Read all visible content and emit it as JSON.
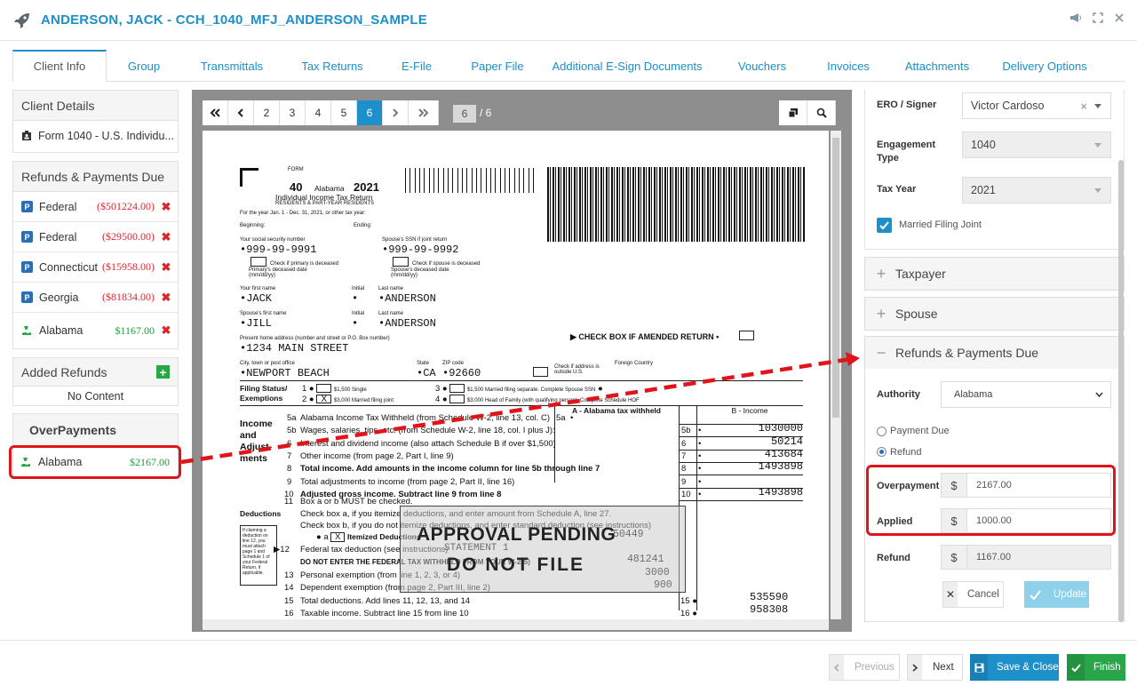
{
  "window": {
    "title": "ANDERSON, JACK - CCH_1040_MFJ_ANDERSON_SAMPLE",
    "icons": [
      "rocket-icon",
      "megaphone-icon",
      "expand-icon",
      "close-icon"
    ]
  },
  "tabs": [
    {
      "label": "Client Info",
      "active": true
    },
    {
      "label": "Group"
    },
    {
      "label": "Transmittals"
    },
    {
      "label": "Tax Returns"
    },
    {
      "label": "E-File"
    },
    {
      "label": "Paper File"
    },
    {
      "label": "Additional E-Sign Documents"
    },
    {
      "label": "Vouchers"
    },
    {
      "label": "Invoices"
    },
    {
      "label": "Attachments"
    },
    {
      "label": "Delivery Options"
    }
  ],
  "left": {
    "client_details": {
      "header": "Client Details",
      "item": "Form 1040 - U.S. Individu..."
    },
    "refunds": {
      "header": "Refunds & Payments Due",
      "items": [
        {
          "name": "Federal",
          "amount": "($501224.00)",
          "kind": "payment"
        },
        {
          "name": "Federal",
          "amount": "($29500.00)",
          "kind": "payment"
        },
        {
          "name": "Connecticut",
          "amount": "($15958.00)",
          "kind": "payment"
        },
        {
          "name": "Georgia",
          "amount": "($81834.00)",
          "kind": "payment"
        },
        {
          "name": "Alabama",
          "amount": "$1167.00",
          "kind": "refund"
        }
      ]
    },
    "added_refunds": {
      "header": "Added Refunds",
      "empty": "No Content"
    },
    "overpayments": {
      "header": "OverPayments",
      "item_name": "Alabama",
      "item_amount": "$2167.00"
    }
  },
  "viewer": {
    "pages": [
      "2",
      "3",
      "4",
      "5",
      "6"
    ],
    "current_page": "6",
    "page_of": "/ 6",
    "form": {
      "form_word": "FORM",
      "form_no": "40",
      "state": "Alabama",
      "year": "2021",
      "subtitle1": "Individual Income Tax Return",
      "subtitle2": "RESIDENTS & PART-YEAR RESIDENTS",
      "period": "For the year Jan. 1 - Dec. 31, 2021, or other tax year:",
      "beginning": "Beginning:",
      "ending": "Ending:",
      "ssn_label": "Your social security number",
      "ssn": "999-99-9991",
      "spouse_ssn_label": "Spouse's SSN if joint return",
      "spouse_ssn": "999-99-9992",
      "deceased1": "Check if primary is deceased",
      "deceased1b": "Primary's deceased date (mm/dd/yy)",
      "deceased2": "Check if spouse is deceased",
      "deceased2b": "Spouse's deceased date (mm/dd/yy)",
      "first_name_label": "Your first name",
      "initial_label": "Initial",
      "last_name_label": "Last name",
      "first_name": "JACK",
      "last_name": "ANDERSON",
      "spouse_first_label": "Spouse's first name",
      "spouse_first": "JILL",
      "spouse_last": "ANDERSON",
      "amended": "CHECK BOX IF AMENDED RETURN",
      "address_label": "Present home address (number and street or P.O. Box number)",
      "address": "1234 MAIN STREET",
      "city_label": "City, town or post office",
      "state_label": "State",
      "zip_label": "ZIP code",
      "check_outside": "Check if address is outside U.S.",
      "foreign": "Foreign Country",
      "city": "NEWPORT BEACH",
      "state_val": "CA",
      "zip": "92660",
      "filing_status": "Filing Status/ Exemptions",
      "fs1": "$1,500 Single",
      "fs2": "$3,000 Married filing joint",
      "fs3": "$1,500 Married filing separate. Complete Spouse SSN",
      "fs4": "$3,000 Head of Family (with qualifying person). Complete Schedule HOF",
      "col_a": "A - Alabama tax withheld",
      "col_b": "B - Income",
      "income_head": "Income and Adjust-ments",
      "lines": [
        {
          "no": "5a",
          "text": "Alabama Income Tax Withheld (from Schedule W-2, line 13, col. C)",
          "ref": "5a"
        },
        {
          "no": "5b",
          "text": "Wages, salaries, tips, etc. (from Schedule W-2, line 18, col. I plus J):",
          "ref": "5b",
          "val": "1030000"
        },
        {
          "no": "6",
          "text": "Interest and dividend income (also attach Schedule B if over $1,500)",
          "ref": "6",
          "val": "50214"
        },
        {
          "no": "7",
          "text": "Other income (from page 2, Part I, line 9)",
          "ref": "7",
          "val": "413684"
        },
        {
          "no": "8",
          "text": "Total income. Add amounts in the income column for line 5b through line 7",
          "ref": "8",
          "val": "1493898"
        },
        {
          "no": "9",
          "text": "Total adjustments to income (from page 2, Part II, line 16)",
          "ref": "9"
        },
        {
          "no": "10",
          "text": "Adjusted gross income. Subtract line 9 from line 8",
          "ref": "10",
          "val": "1493898"
        }
      ],
      "deductions_head": "Deductions",
      "l11": "Box a or b MUST be checked.",
      "l11a": "Check box a, if you itemize deductions, and enter amount from Schedule A, line 27.",
      "l11b": "Check box b, if you do not itemize deductions, and enter standard deduction (see instructions)",
      "l11c": "Itemized Deductions",
      "l11val": "50449",
      "statement": "STATEMENT 1",
      "l12": "Federal tax deduction (see instructions)",
      "l12b": "DO NOT ENTER THE FEDERAL TAX WITHHELD FROM YOUR W-2(S)",
      "l12val": "481241",
      "l13": "Personal exemption (from line 1, 2, 3, or 4)",
      "l13val": "3000",
      "l14": "Dependent exemption (from page 2, Part III, line 2)",
      "l14val": "900",
      "l15": "Total deductions. Add lines 11, 12, 13, and 14",
      "l15val": "535590",
      "l16": "Taxable income. Subtract line 15 from line 10",
      "l16val": "958308",
      "side_note": "If claiming a deduction on line 12, you must attach page 1 and Schedule 1 of your Federal Return, if applicable.",
      "stamp1": "APPROVAL PENDING",
      "stamp2": "DO NOT FILE"
    }
  },
  "right": {
    "ero_label": "ERO / Signer",
    "ero_value": "Victor Cardoso",
    "engagement_label": "Engagement Type",
    "engagement_value": "1040",
    "tax_year_label": "Tax Year",
    "tax_year_value": "2021",
    "mfj_label": "Married Filing Joint",
    "taxpayer": "Taxpayer",
    "spouse": "Spouse",
    "refunds_header": "Refunds & Payments Due",
    "authority_label": "Authority",
    "authority_value": "Alabama",
    "payment_due": "Payment Due",
    "refund": "Refund",
    "overpayment_label": "Overpayment",
    "overpayment_value": "2167.00",
    "applied_label": "Applied",
    "applied_value": "1000.00",
    "refund_label": "Refund",
    "refund_value": "1167.00",
    "currency": "$",
    "cancel": "Cancel",
    "update": "Update"
  },
  "footer": {
    "previous": "Previous",
    "next": "Next",
    "save_close": "Save & Close",
    "finish": "Finish"
  },
  "colors": {
    "accent": "#1d8fc9",
    "red": "#d9272e",
    "green": "#28a745",
    "annotation": "#e0141b"
  }
}
